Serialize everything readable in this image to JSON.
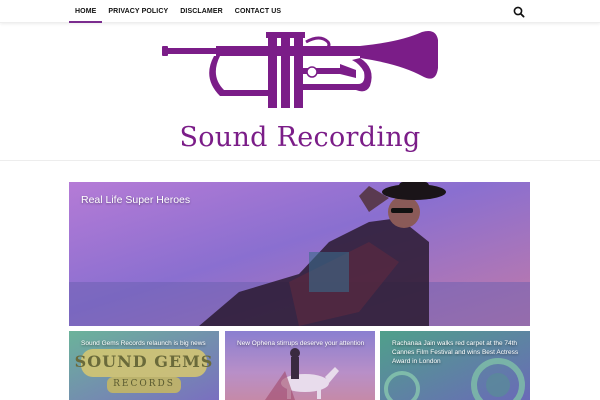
{
  "nav": {
    "items": [
      {
        "label": "HOME"
      },
      {
        "label": "PRIVACY POLICY"
      },
      {
        "label": "DISCLAMER"
      },
      {
        "label": "CONTACT US"
      }
    ]
  },
  "site": {
    "title": "Sound Recording",
    "brand_color": "#7b1d88"
  },
  "featured": {
    "title": "Real Life Super Heroes"
  },
  "posts": [
    {
      "title": "Sound Gems Records relaunch is big news",
      "image_text_top": "SOUND",
      "image_text_mid": "GEMS",
      "image_text_bottom": "RECORDS"
    },
    {
      "title": "New Ophena stirrups deserve your attention"
    },
    {
      "title": "Rachanaa Jain walks red carpet at the 74th Cannes Film Festival and wins Best Actress Award in London"
    }
  ]
}
